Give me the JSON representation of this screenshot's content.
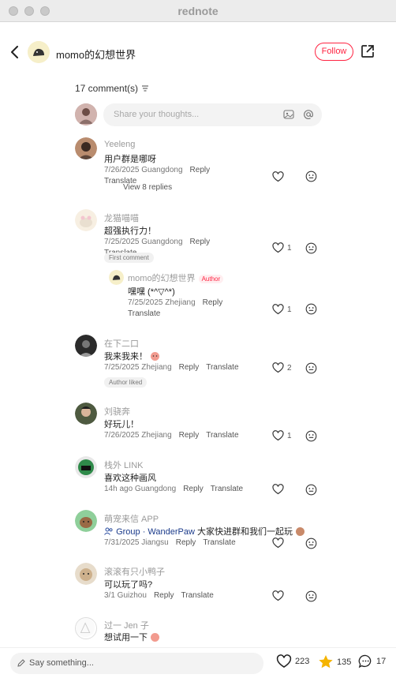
{
  "app": {
    "title": "rednote"
  },
  "post": {
    "author_name": "momo的幻想世界",
    "follow_label": "Follow"
  },
  "comments_header": {
    "count_label": "17 comment(s)"
  },
  "composer": {
    "placeholder": "Share your thoughts..."
  },
  "comments": [
    {
      "user": "Yeeleng",
      "text": "用户群是哪呀",
      "date": "7/26/2025 Guangdong",
      "reply": "Reply",
      "translate": "Translate",
      "likes": "",
      "view_replies": "View 8 replies"
    },
    {
      "user": "龙猫喵喵",
      "text": "超强执行力！",
      "date": "7/25/2025 Guangdong",
      "reply": "Reply",
      "translate": "Translate",
      "likes": "1",
      "badge": "First comment",
      "reply_item": {
        "user": "momo的幻想世界",
        "author_tag": "Author",
        "text": "嘿嘿 (*^▽^*)",
        "date": "7/25/2025 Zhejiang",
        "reply": "Reply",
        "translate": "Translate",
        "likes": "1"
      }
    },
    {
      "user": "在下二口",
      "text": "我来我来！",
      "date": "7/25/2025 Zhejiang",
      "reply": "Reply",
      "translate": "Translate",
      "likes": "2",
      "badge": "Author liked"
    },
    {
      "user": "刘骁奔",
      "text": "好玩儿！",
      "date": "7/26/2025 Zhejiang",
      "reply": "Reply",
      "translate": "Translate",
      "likes": "1"
    },
    {
      "user": "栈外 LINK",
      "text": "喜欢这种画风",
      "date": "14h ago Guangdong",
      "reply": "Reply",
      "translate": "Translate",
      "likes": ""
    },
    {
      "user": "萌宠来信 APP",
      "text_prefix": "Group · WanderPaw",
      "text": "大家快进群和我们一起玩",
      "date": "7/31/2025 Jiangsu",
      "reply": "Reply",
      "translate": "Translate",
      "likes": ""
    },
    {
      "user": "滚滚有只小鸭子",
      "text": "可以玩了吗?",
      "date": "3/1 Guizhou",
      "reply": "Reply",
      "translate": "Translate",
      "likes": ""
    },
    {
      "user": "过一 Jen 子",
      "text": "想试用一下"
    }
  ],
  "footer": {
    "say_placeholder": "Say something...",
    "likes": "223",
    "stars": "135",
    "comments": "17"
  },
  "colors": {
    "accent": "#ff2442",
    "star": "#f5b400"
  }
}
